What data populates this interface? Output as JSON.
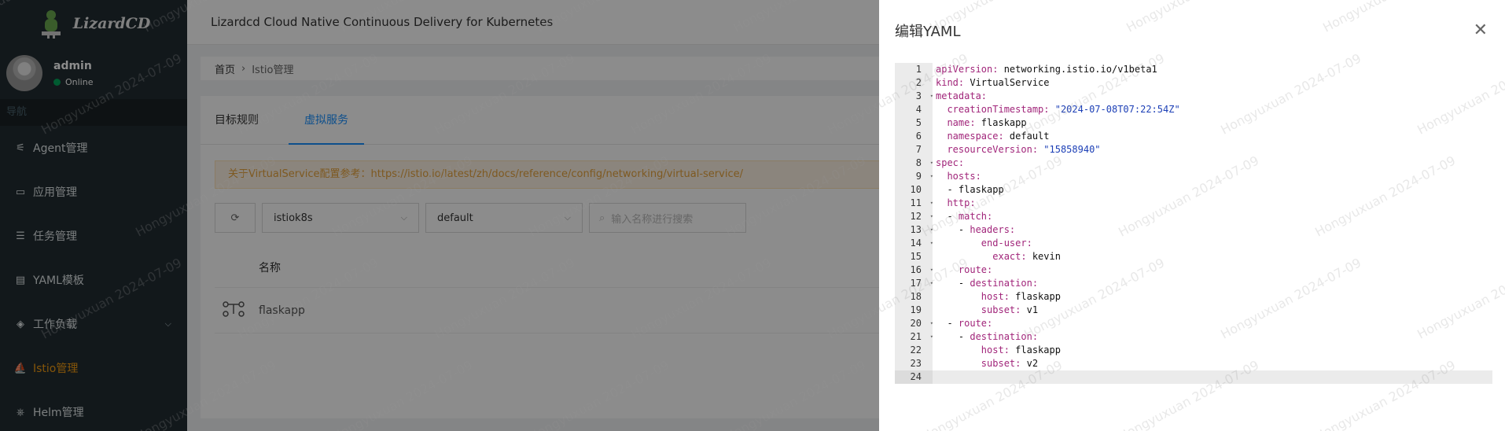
{
  "app": {
    "logo_text": "LizardCD",
    "header_title": "Lizardcd Cloud Native Continuous Delivery for Kubernetes"
  },
  "user": {
    "name": "admin",
    "status": "Online"
  },
  "sidebar": {
    "nav_header": "导航",
    "items": [
      {
        "label": "Agent管理",
        "icon": "sliders-icon"
      },
      {
        "label": "应用管理",
        "icon": "monitor-icon"
      },
      {
        "label": "任务管理",
        "icon": "list-icon"
      },
      {
        "label": "YAML模板",
        "icon": "file-icon"
      },
      {
        "label": "工作负载",
        "icon": "layers-icon"
      },
      {
        "label": "Istio管理",
        "icon": "sail-icon"
      },
      {
        "label": "Helm管理",
        "icon": "helm-icon"
      }
    ]
  },
  "breadcrumb": {
    "home": "首页",
    "current": "Istio管理"
  },
  "tabs": [
    {
      "label": "目标规则"
    },
    {
      "label": "虚拟服务"
    }
  ],
  "alert": {
    "text": "关于VirtualService配置参考：https://istio.io/latest/zh/docs/reference/config/networking/virtual-service/"
  },
  "filters": {
    "cluster": "istiok8s",
    "namespace": "default",
    "search_placeholder": "输入名称进行搜索"
  },
  "table": {
    "header_name": "名称",
    "rows": [
      {
        "name": "flaskapp"
      }
    ]
  },
  "drawer": {
    "title": "编辑YAML",
    "yaml_lines": [
      "apiVersion: networking.istio.io/v1beta1",
      "kind: VirtualService",
      "metadata:",
      "  creationTimestamp: \"2024-07-08T07:22:54Z\"",
      "  name: flaskapp",
      "  namespace: default",
      "  resourceVersion: \"15858940\"",
      "spec:",
      "  hosts:",
      "  - flaskapp",
      "  http:",
      "  - match:",
      "    - headers:",
      "        end-user:",
      "          exact: kevin",
      "    route:",
      "    - destination:",
      "        host: flaskapp",
      "        subset: v1",
      "  - route:",
      "    - destination:",
      "        host: flaskapp",
      "        subset: v2",
      ""
    ],
    "fold_lines": [
      3,
      8,
      9,
      11,
      12,
      13,
      14,
      16,
      17,
      20,
      21
    ],
    "current_line": 24
  },
  "watermark": {
    "text": "Hongyuxuan 2024-07-09"
  },
  "colors": {
    "sidebar_bg": "#222d32",
    "accent": "#1890ff",
    "active_menu": "#f39c12",
    "yaml_key": "#a1257a",
    "yaml_string": "#1c3fb6"
  }
}
